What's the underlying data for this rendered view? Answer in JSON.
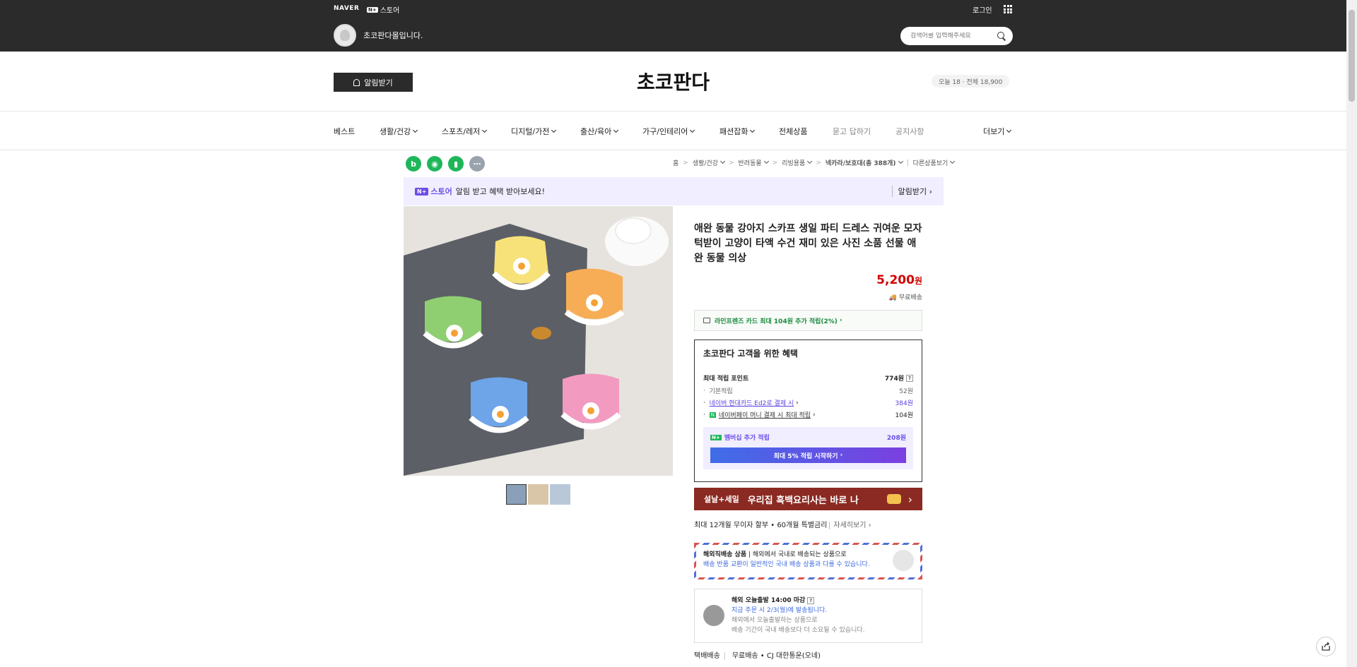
{
  "topbar": {
    "naver": "NAVER",
    "nstore_badge": "N+",
    "nstore_label": "스토어",
    "login": "로그인",
    "store_name": "초코판다몰입니다.",
    "search_placeholder": "검색어를 입력해주세요"
  },
  "header": {
    "alarm_button": "알림받기",
    "logo": "초코판다",
    "visitors": "오늘 18 · 전체 18,900"
  },
  "nav": {
    "items": [
      "베스트",
      "생활/건강",
      "스포츠/레저",
      "디지털/가전",
      "출산/육아",
      "가구/인테리어",
      "패션잡화",
      "전체상품",
      "묻고 답하기",
      "공지사항",
      "더보기"
    ]
  },
  "breadcrumb": [
    "홈",
    "생활/건강",
    "반려동물",
    "리빙용품",
    "넥카라/보호대(총 388개)",
    "다른상품보기"
  ],
  "banner": {
    "badge": "N+",
    "store": "스토어",
    "message": "알림 받고 혜택 받아보세요!",
    "action": "알림받기"
  },
  "product": {
    "title": "애완 동물 강아지 스카프 생일 파티 드레스 귀여운 모자 턱받이 고양이 타액 수건 재미 있은 사진 소품 선물 애완 동물 의상",
    "price": "5,200",
    "price_unit": "원",
    "delivery": "무료배송",
    "card_benefit": "라인프렌즈 카드 최대 104원 추가 적립(2%)"
  },
  "points": {
    "title": "초코판다 고객을 위한 혜택",
    "max_label": "최대 적립 포인트",
    "max_value": "774원",
    "basic_label": "기본적립",
    "basic_value": "52원",
    "card_label": "네이버 현대카드 Ed2로 결제 시",
    "card_value": "384원",
    "pay_label": "네이버페이 머니 결제 시 최대 적립",
    "pay_value": "104원",
    "membership_label": "멤버십 추가 적립",
    "membership_value": "208원",
    "membership_button": "최대 5% 적립 시작하기"
  },
  "sale_banner": {
    "left": "설날+세일",
    "right": "우리집 흑백요리사는 바로 나"
  },
  "installment": {
    "text": "최대 12개월 무이자 할부 • 60개월 특별금리",
    "more": "자세히보기"
  },
  "overseas": {
    "label": "해외직배송 상품",
    "text": "해외에서 국내로 배송되는 상품으로",
    "note": "배송 반품 교환이 일반적인 국내 배송 상품과 다를 수 있습니다."
  },
  "today_ship": {
    "title": "해외 오늘출발 14:00 마감",
    "line1": "지금 주문 시 2/3(월)에 발송됩니다.",
    "line2": "해외에서 오늘출발하는 상품으로",
    "line3": "배송 기간이 국내 배송보다 더 소요될 수 있습니다."
  },
  "shipping": {
    "label": "택배배송",
    "value": "무료배송 • CJ 대한통운(오네)"
  },
  "colors": {
    "dark_bar": "#2b2b2b",
    "price_red": "#d10000",
    "naver_purple": "#6b4de6",
    "green": "#1a8a3c"
  },
  "icons": [
    "naver-blog-icon",
    "talk-icon",
    "bookmark-icon",
    "more-icon",
    "bell-icon",
    "search-icon",
    "apps-grid-icon",
    "card-icon",
    "share-icon"
  ]
}
